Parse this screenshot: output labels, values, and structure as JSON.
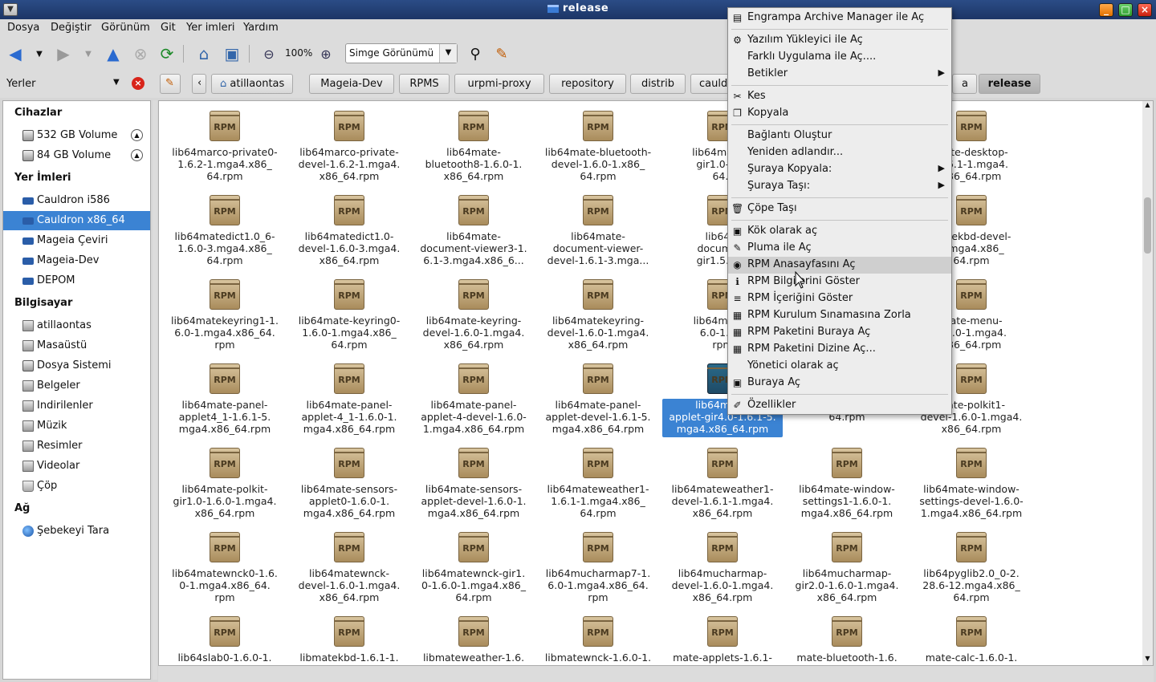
{
  "window": {
    "title": "release"
  },
  "menubar": [
    "Dosya",
    "Değiştir",
    "Görünüm",
    "Git",
    "Yer imleri",
    "Yardım"
  ],
  "toolbar": {
    "zoom": "100%",
    "view_mode": "Simge Görünümü"
  },
  "places": {
    "title": "Yerler"
  },
  "breadcrumbs": [
    "atillaontas",
    "Mageia-Dev",
    "RPMS",
    "urpmi-proxy",
    "repository",
    "distrib",
    "cauldron",
    "a",
    "release"
  ],
  "sidebar": {
    "headers": [
      "Cihazlar",
      "Yer İmleri",
      "Bilgisayar",
      "Ağ"
    ],
    "devices": [
      "532 GB Volume",
      "84 GB Volume"
    ],
    "bookmarks": [
      "Cauldron i586",
      "Cauldron x86_64",
      "Mageia Çeviri",
      "Mageia-Dev",
      "DEPOM"
    ],
    "computer": [
      "atillaontas",
      "Masaüstü",
      "Dosya Sistemi",
      "Belgeler",
      "Indirilenler",
      "Müzik",
      "Resimler",
      "Videolar",
      "Çöp"
    ],
    "network": [
      "Şebekeyi Tara"
    ]
  },
  "icon_label": "RPM",
  "files": [
    "lib64marco-private0-\n1.6.2-1.mga4.x86_\n64.rpm",
    "lib64marco-private-\ndevel-1.6.2-1.mga4.\nx86_64.rpm",
    "lib64mate-\nbluetooth8-1.6.0-1.\nx86_64.rpm",
    "lib64mate-bluetooth-\ndevel-1.6.0-1.x86_\n64.rpm",
    "lib64mate-b\ngir1.0-1.6-\n64.r",
    "",
    "mate-desktop-\n.1.6.1-1.mga4.\nx86_64.rpm",
    "lib64matedict1.0_6-\n1.6.0-3.mga4.x86_\n64.rpm",
    "lib64matedict1.0-\ndevel-1.6.0-3.mga4.\nx86_64.rpm",
    "lib64mate-\ndocument-viewer3-1.\n6.1-3.mga4.x86_6...",
    "lib64mate-\ndocument-viewer-\ndevel-1.6.1-3.mga...",
    "lib64m\ndocument\ngir1.5.0-1.",
    "",
    "matekbd-devel-\n1.mga4.x86_\n64.rpm",
    "lib64matekeyring1-1.\n6.0-1.mga4.x86_64.\nrpm",
    "lib64mate-keyring0-\n1.6.0-1.mga4.x86_\n64.rpm",
    "lib64mate-keyring-\ndevel-1.6.0-1.mga4.\nx86_64.rpm",
    "lib64matekeyring-\ndevel-1.6.0-1.mga4.\nx86_64.rpm",
    "lib64mate-r\n6.0-1.mg\nrpm",
    "",
    "mate-menu-\n1.6.0-1.mga4.\nx86_64.rpm",
    "lib64mate-panel-\napplet4_1-1.6.1-5.\nmga4.x86_64.rpm",
    "lib64mate-panel-\napplet-4_1-1.6.0-1.\nmga4.x86_64.rpm",
    "lib64mate-panel-\napplet-4-devel-1.6.0-\n1.mga4.x86_64.rpm",
    "lib64mate-panel-\napplet-devel-1.6.1-5.\nmga4.x86_64.rpm",
    "lib64mate-\napplet-gir4.0-1.6.1-5.\nmga4.x86_64.rpm",
    "1.6.0-1.mga4.x86_\n64.rpm",
    "mate-polkit1-\ndevel-1.6.0-1.mga4.\nx86_64.rpm",
    "lib64mate-polkit-\ngir1.0-1.6.0-1.mga4.\nx86_64.rpm",
    "lib64mate-sensors-\napplet0-1.6.0-1.\nmga4.x86_64.rpm",
    "lib64mate-sensors-\napplet-devel-1.6.0-1.\nmga4.x86_64.rpm",
    "lib64mateweather1-\n1.6.1-1.mga4.x86_\n64.rpm",
    "lib64mateweather1-\ndevel-1.6.1-1.mga4.\nx86_64.rpm",
    "lib64mate-window-\nsettings1-1.6.0-1.\nmga4.x86_64.rpm",
    "lib64mate-window-\nsettings-devel-1.6.0-\n1.mga4.x86_64.rpm",
    "lib64matewnck0-1.6.\n0-1.mga4.x86_64.\nrpm",
    "lib64matewnck-\ndevel-1.6.0-1.mga4.\nx86_64.rpm",
    "lib64matewnck-gir1.\n0-1.6.0-1.mga4.x86_\n64.rpm",
    "lib64mucharmap7-1.\n6.0-1.mga4.x86_64.\nrpm",
    "lib64mucharmap-\ndevel-1.6.0-1.mga4.\nx86_64.rpm",
    "lib64mucharmap-\ngir2.0-1.6.0-1.mga4.\nx86_64.rpm",
    "lib64pyglib2.0_0-2.\n28.6-12.mga4.x86_\n64.rpm",
    "lib64slab0-1.6.0-1.",
    "libmatekbd-1.6.1-1.",
    "libmateweather-1.6.",
    "libmatewnck-1.6.0-1.",
    "mate-applets-1.6.1-",
    "mate-bluetooth-1.6.",
    "mate-calc-1.6.0-1."
  ],
  "context_menu": [
    {
      "label": "Engrampa Archive Manager ile Aç",
      "icon": "archive-icon"
    },
    {
      "sep": true
    },
    {
      "label": "Yazılım Yükleyici ile Aç",
      "icon": "installer-icon"
    },
    {
      "label": "Farklı Uygulama ile Aç....",
      "icon": ""
    },
    {
      "label": "Betikler",
      "icon": "",
      "submenu": true
    },
    {
      "sep": true
    },
    {
      "label": "Kes",
      "icon": "scissors-icon"
    },
    {
      "label": "Kopyala",
      "icon": "copy-icon"
    },
    {
      "sep": true
    },
    {
      "label": "Bağlantı Oluştur",
      "icon": ""
    },
    {
      "label": "Yeniden adlandır...",
      "icon": ""
    },
    {
      "label": "Şuraya Kopyala:",
      "icon": "",
      "submenu": true
    },
    {
      "label": "Şuraya Taşı:",
      "icon": "",
      "submenu": true
    },
    {
      "sep": true
    },
    {
      "label": "Çöpe Taşı",
      "icon": "trash-icon"
    },
    {
      "sep": true
    },
    {
      "label": "Kök olarak aç",
      "icon": "terminal-icon"
    },
    {
      "label": "Pluma ile Aç",
      "icon": "editor-icon"
    },
    {
      "label": "RPM Anasayfasını Aç",
      "icon": "globe-icon",
      "highlighted": true
    },
    {
      "label": "RPM Bilgilerini Göster",
      "icon": "info-icon"
    },
    {
      "label": "RPM İçeriğini Göster",
      "icon": "list-icon"
    },
    {
      "label": "RPM Kurulum Sınamasına Zorla",
      "icon": "package-icon"
    },
    {
      "label": "RPM Paketini Buraya Aç",
      "icon": "package-icon"
    },
    {
      "label": "RPM Paketini Dizine Aç...",
      "icon": "package-icon"
    },
    {
      "label": "Yönetici olarak aç",
      "icon": ""
    },
    {
      "label": "Buraya Aç",
      "icon": "terminal-icon"
    },
    {
      "sep": true
    },
    {
      "label": "Özellikler",
      "icon": "properties-icon"
    }
  ]
}
